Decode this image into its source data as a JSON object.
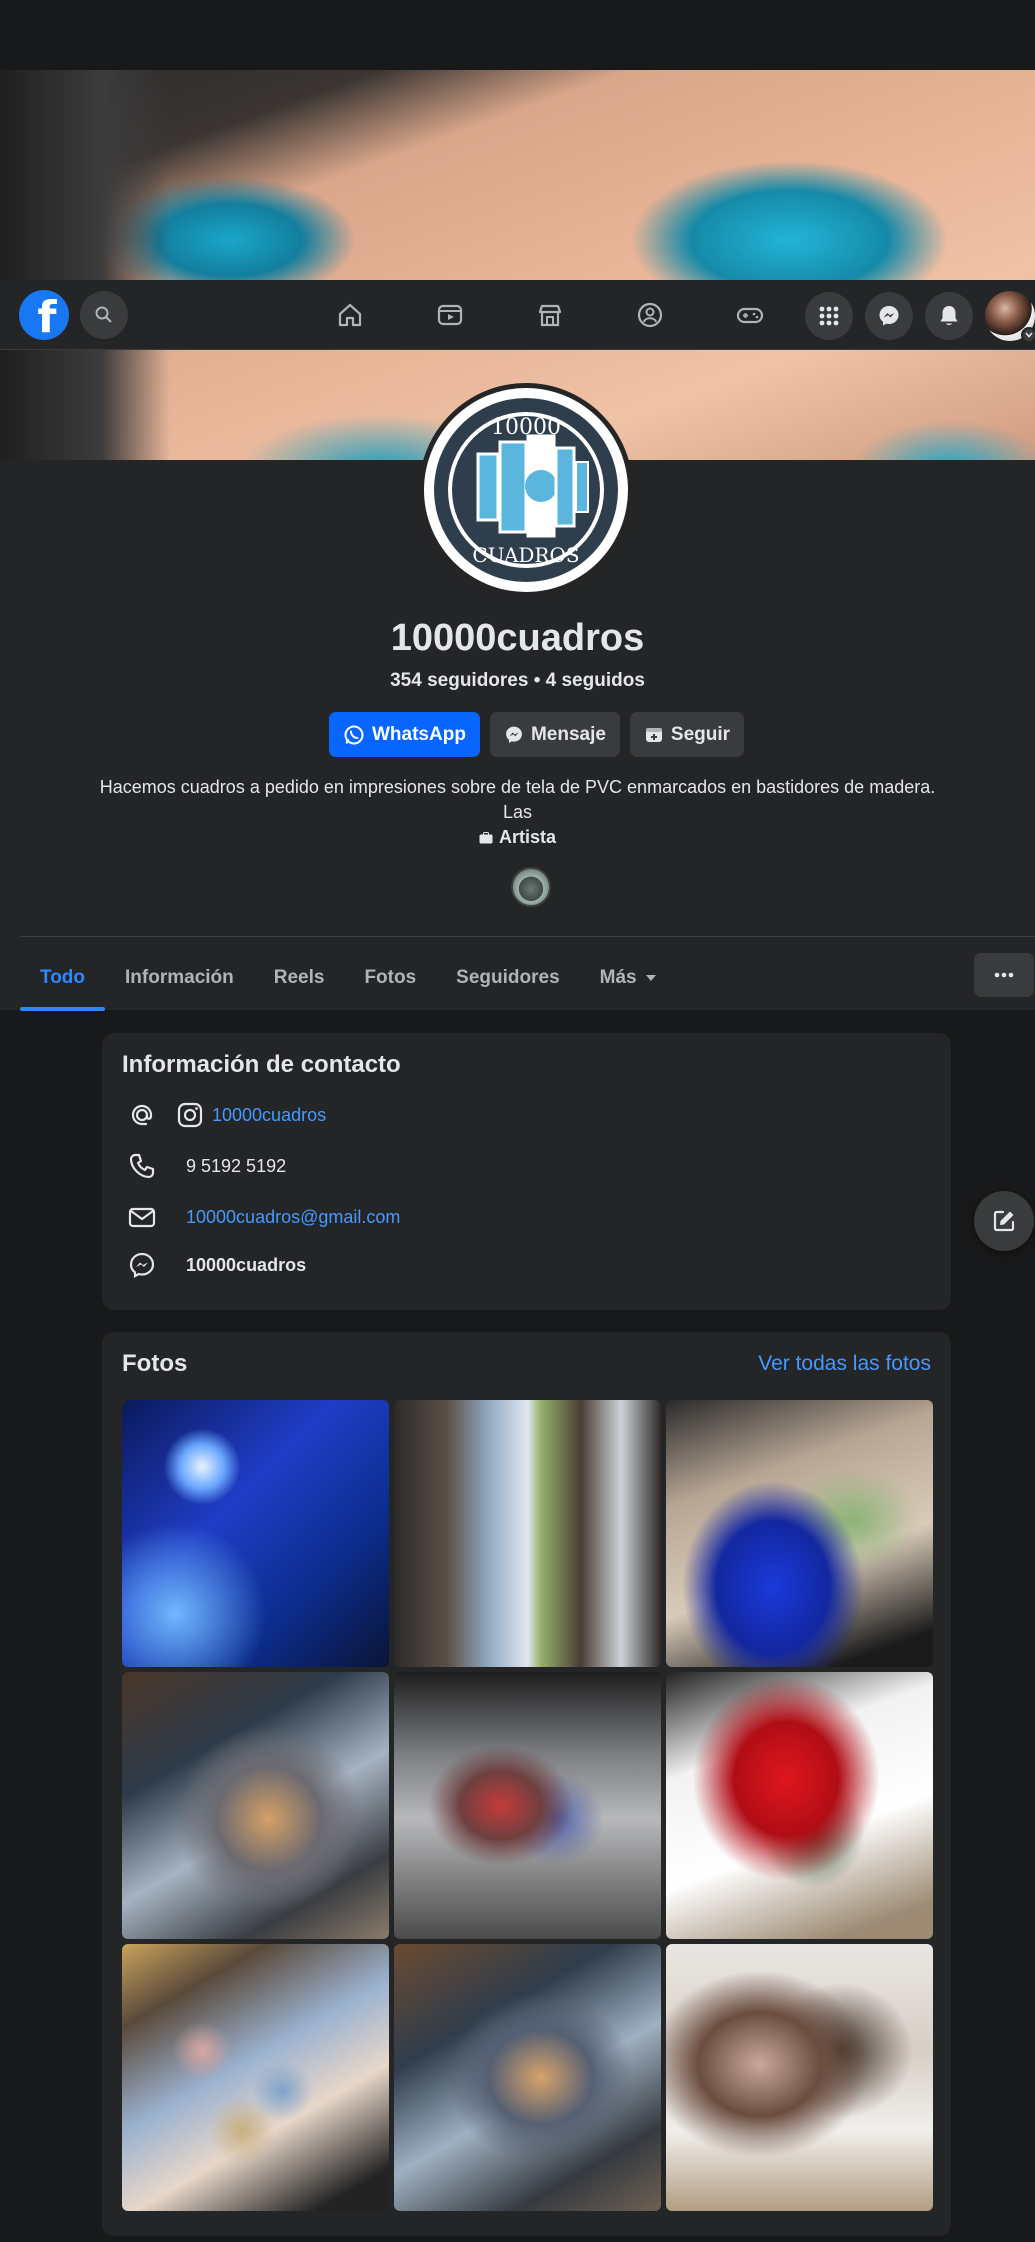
{
  "nav": {
    "logo_letter": "f",
    "tabs": [
      "home-icon",
      "video-icon",
      "marketplace-icon",
      "groups-icon",
      "gaming-icon"
    ],
    "right": [
      "menu-grid-icon",
      "messenger-icon",
      "bell-icon"
    ]
  },
  "profile": {
    "name": "10000cuadros",
    "logo_top_text": "10000",
    "logo_bottom_text": "CUADROS",
    "followers_line": "354 seguidores • 4 seguidos",
    "bio_line1": "Hacemos cuadros a pedido en impresiones sobre de tela de PVC enmarcados en bastidores de madera.",
    "bio_line2": "Las",
    "category": "Artista"
  },
  "actions": {
    "whatsapp": "WhatsApp",
    "message": "Mensaje",
    "follow": "Seguir"
  },
  "tabs": [
    {
      "label": "Todo"
    },
    {
      "label": "Información"
    },
    {
      "label": "Reels"
    },
    {
      "label": "Fotos"
    },
    {
      "label": "Seguidores"
    },
    {
      "label": "Más"
    }
  ],
  "contact": {
    "title": "Información de contacto",
    "instagram": "10000cuadros",
    "phone": "9 5192 5192",
    "email": "10000cuadros@gmail.com",
    "messenger": "10000cuadros"
  },
  "photos": {
    "title": "Fotos",
    "see_all": "Ver todas las fotos"
  },
  "colors": {
    "accent": "#0866ff",
    "link": "#4599ff",
    "background": "#18191a",
    "card": "#242526"
  }
}
